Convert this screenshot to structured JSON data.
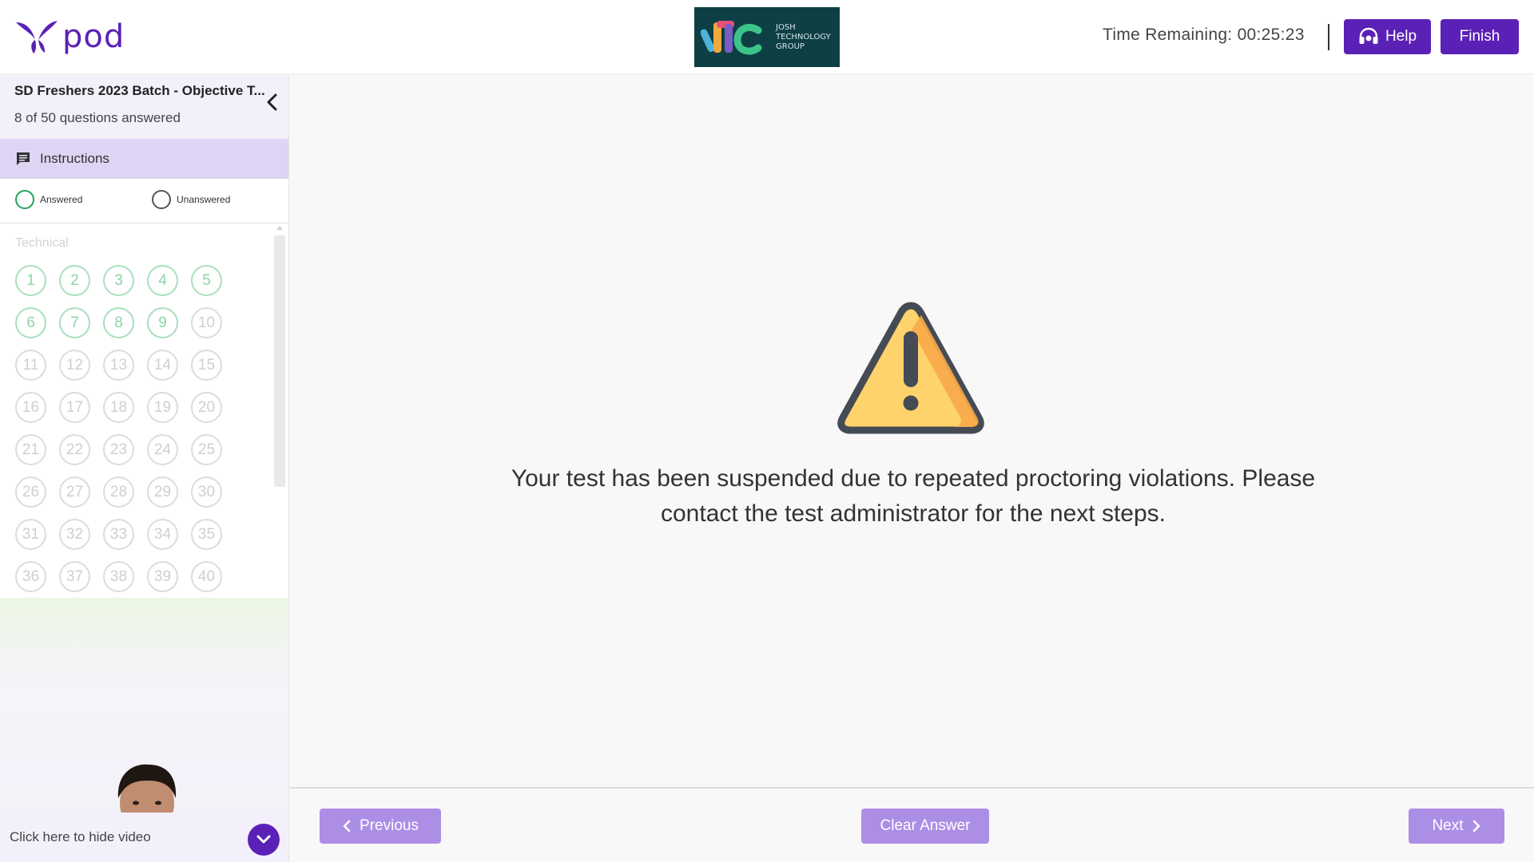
{
  "header": {
    "app_name": "pod",
    "brand_text": "JOSH\nTECHNOLOGY\nGROUP",
    "timer": "Time Remaining: 00:25:23",
    "help_label": "Help",
    "finish_label": "Finish"
  },
  "sidebar": {
    "test_title": "SD Freshers 2023 Batch - Objective T...",
    "progress": "8 of 50 questions answered",
    "instructions_label": "Instructions",
    "legend": {
      "answered": "Answered",
      "unanswered": "Unanswered"
    },
    "section": "Technical",
    "questions": [
      {
        "n": "1",
        "answered": true
      },
      {
        "n": "2",
        "answered": true
      },
      {
        "n": "3",
        "answered": true
      },
      {
        "n": "4",
        "answered": true
      },
      {
        "n": "5",
        "answered": true
      },
      {
        "n": "6",
        "answered": true
      },
      {
        "n": "7",
        "answered": true
      },
      {
        "n": "8",
        "answered": true
      },
      {
        "n": "9",
        "answered": true
      },
      {
        "n": "10",
        "answered": false
      },
      {
        "n": "11",
        "answered": false
      },
      {
        "n": "12",
        "answered": false
      },
      {
        "n": "13",
        "answered": false
      },
      {
        "n": "14",
        "answered": false
      },
      {
        "n": "15",
        "answered": false
      },
      {
        "n": "16",
        "answered": false
      },
      {
        "n": "17",
        "answered": false
      },
      {
        "n": "18",
        "answered": false
      },
      {
        "n": "19",
        "answered": false
      },
      {
        "n": "20",
        "answered": false
      },
      {
        "n": "21",
        "answered": false
      },
      {
        "n": "22",
        "answered": false
      },
      {
        "n": "23",
        "answered": false
      },
      {
        "n": "24",
        "answered": false
      },
      {
        "n": "25",
        "answered": false
      },
      {
        "n": "26",
        "answered": false
      },
      {
        "n": "27",
        "answered": false
      },
      {
        "n": "28",
        "answered": false
      },
      {
        "n": "29",
        "answered": false
      },
      {
        "n": "30",
        "answered": false
      },
      {
        "n": "31",
        "answered": false
      },
      {
        "n": "32",
        "answered": false
      },
      {
        "n": "33",
        "answered": false
      },
      {
        "n": "34",
        "answered": false
      },
      {
        "n": "35",
        "answered": false
      },
      {
        "n": "36",
        "answered": false
      },
      {
        "n": "37",
        "answered": false
      },
      {
        "n": "38",
        "answered": false
      },
      {
        "n": "39",
        "answered": false
      },
      {
        "n": "40",
        "answered": false
      }
    ],
    "video_toggle_label": "Click here to hide video"
  },
  "main": {
    "message": "Your test has been suspended due to repeated proctoring violations. Please contact the test administrator for the next steps."
  },
  "footer": {
    "previous_label": "Previous",
    "clear_label": "Clear Answer",
    "next_label": "Next"
  },
  "colors": {
    "primary": "#5b21b6",
    "primary_light": "#ad8ee6",
    "answered": "#22a35a",
    "warning_fill": "#ffd36b",
    "warning_border": "#454b54"
  },
  "icons": {
    "logo": "pod-logo-icon",
    "help": "headset-icon",
    "instructions": "chat-icon",
    "collapse": "chevron-left-icon",
    "warning": "warning-triangle-icon",
    "video_toggle": "chevron-down-icon"
  }
}
